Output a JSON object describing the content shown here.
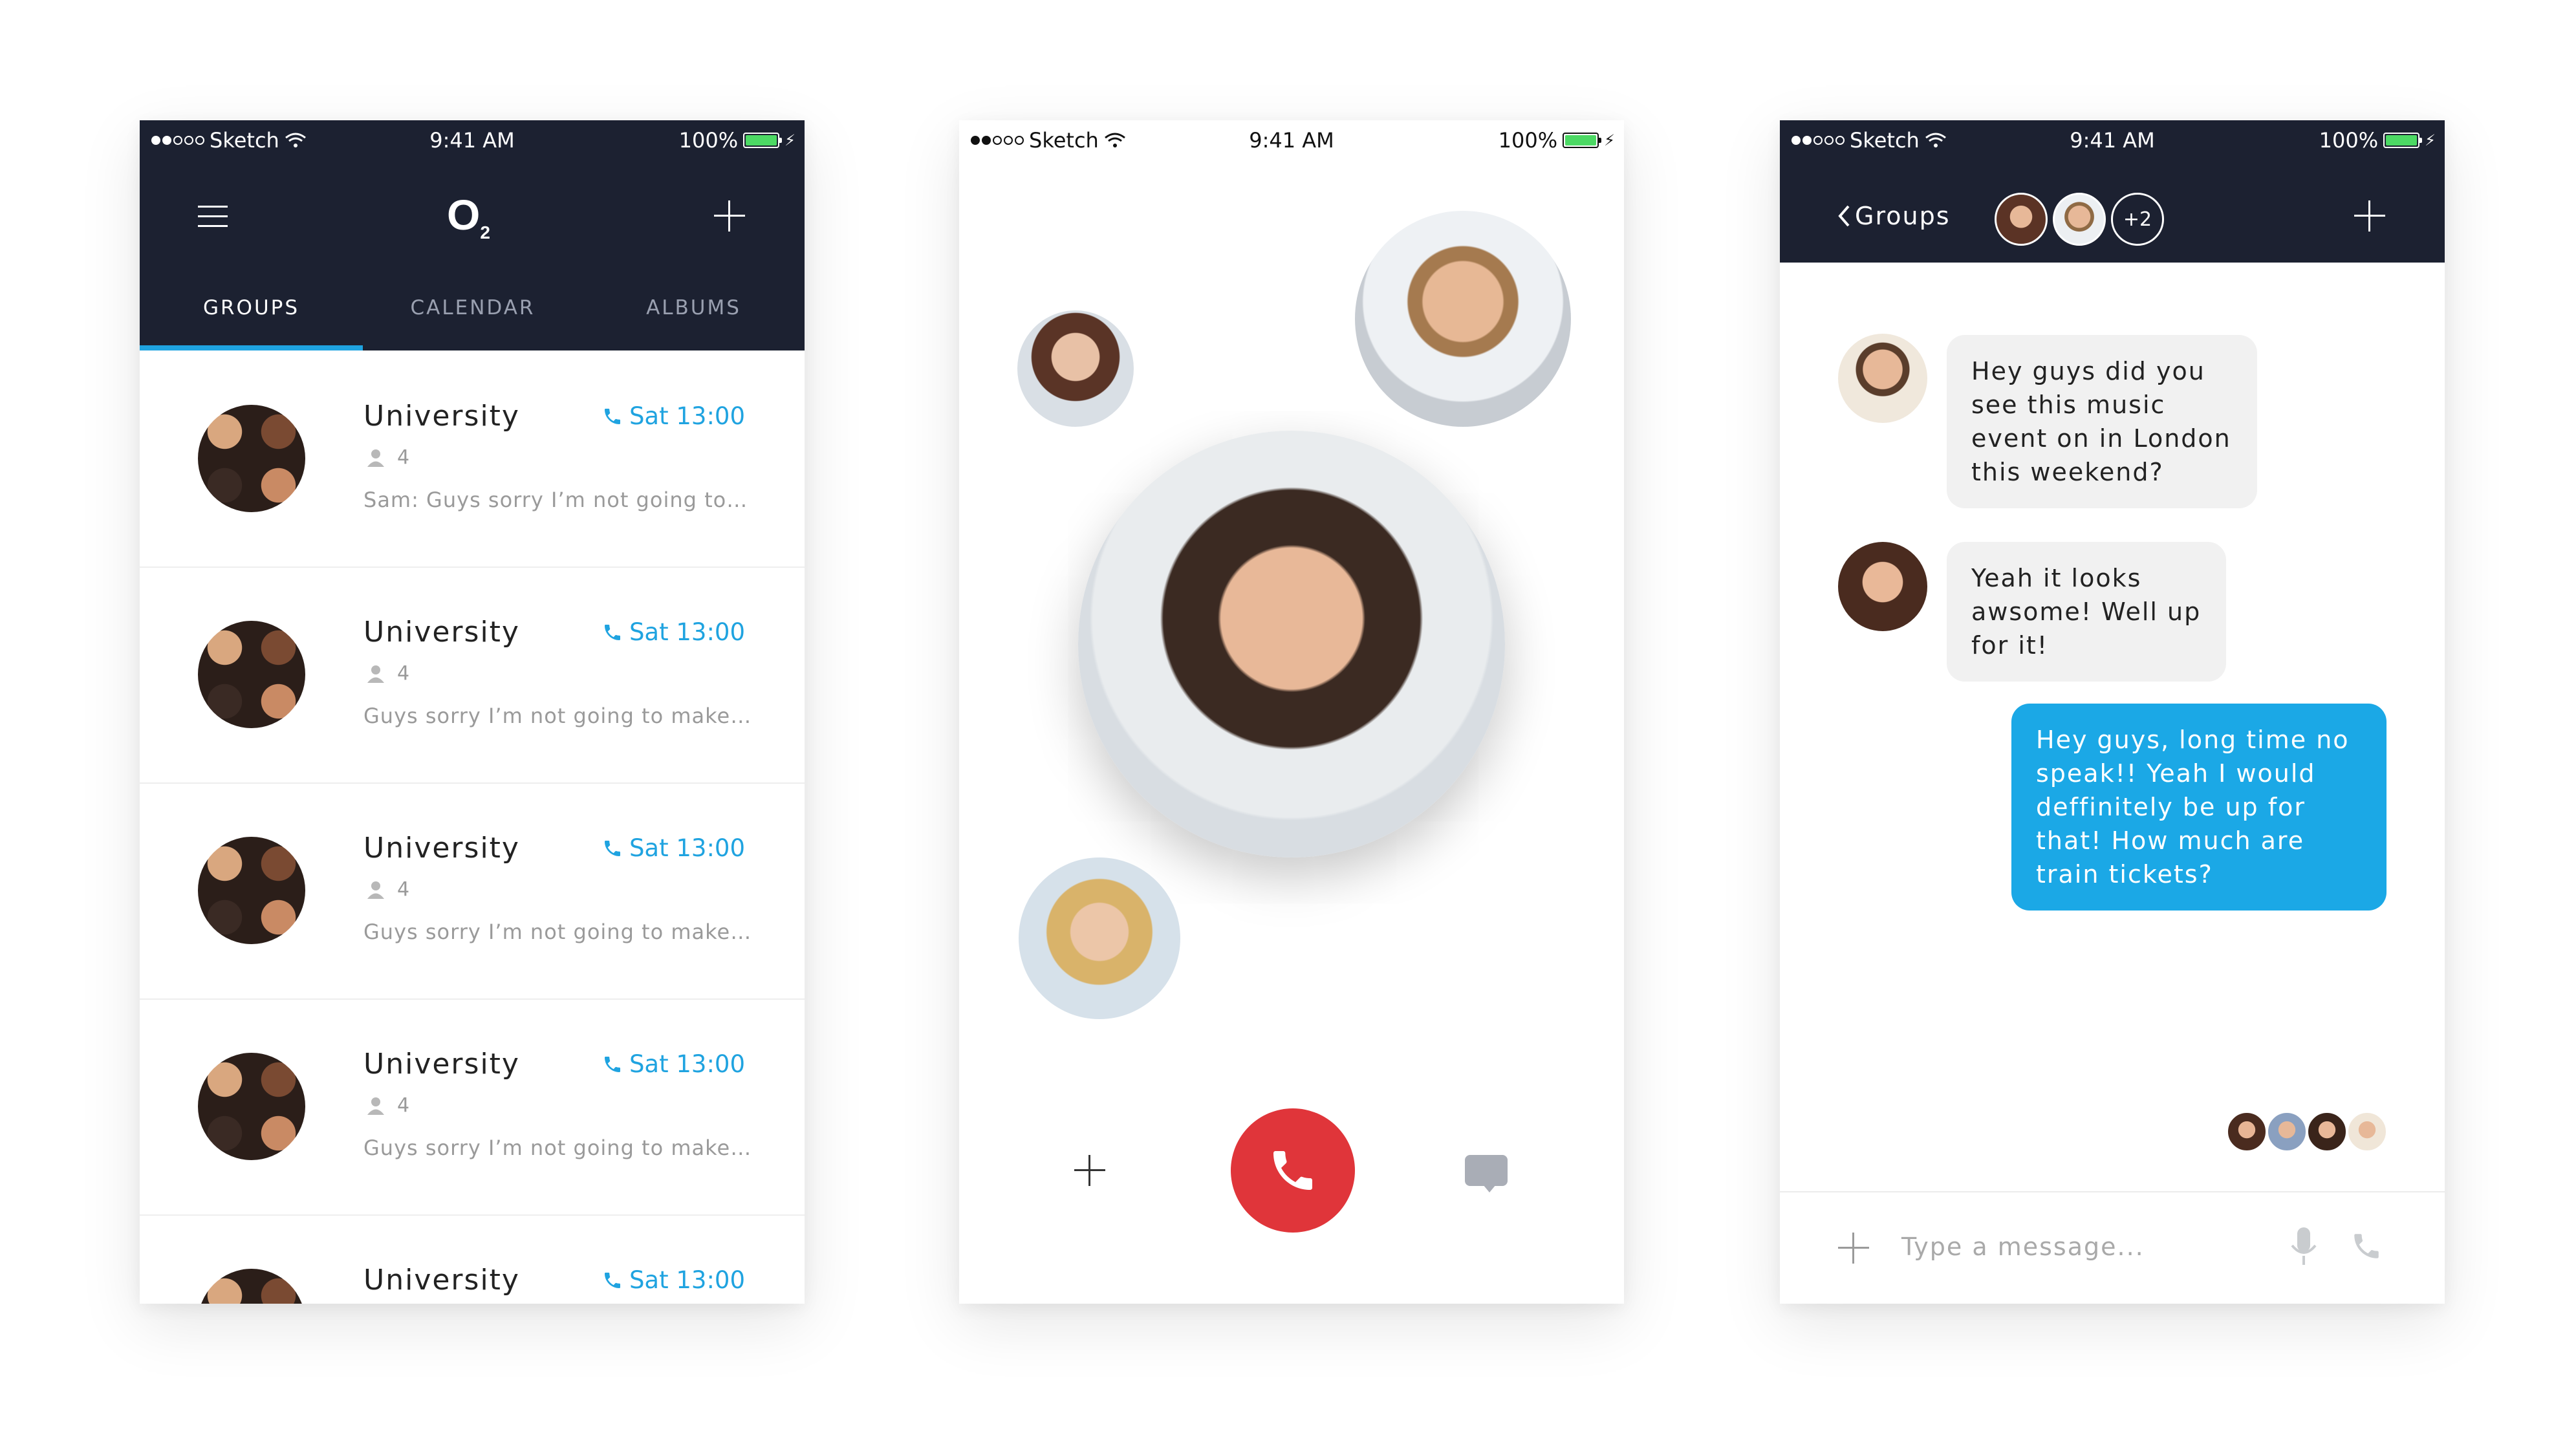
{
  "status_bar": {
    "carrier": "Sketch",
    "time": "9:41 AM",
    "battery": "100%"
  },
  "groups_screen": {
    "logo": "O",
    "logo_sub": "2",
    "tabs": [
      {
        "label": "GROUPS",
        "active": true
      },
      {
        "label": "CALENDAR",
        "active": false
      },
      {
        "label": "ALBUMS",
        "active": false
      }
    ],
    "rows": [
      {
        "title": "University",
        "time": "Sat 13:00",
        "count": "4",
        "preview": "Sam: Guys sorry I’m not going to b…"
      },
      {
        "title": "University",
        "time": "Sat 13:00",
        "count": "4",
        "preview": "Guys sorry I’m not going to make t…"
      },
      {
        "title": "University",
        "time": "Sat 13:00",
        "count": "4",
        "preview": "Guys sorry I’m not going to make t…"
      },
      {
        "title": "University",
        "time": "Sat 13:00",
        "count": "4",
        "preview": "Guys sorry I’m not going to make t…"
      },
      {
        "title": "University",
        "time": "Sat 13:00",
        "count": "",
        "preview": ""
      }
    ]
  },
  "call_screen": {
    "icons": [
      "add-participant-icon",
      "end-call-icon",
      "chat-icon"
    ],
    "colors": {
      "end_call": "#e0353a"
    }
  },
  "chat_screen": {
    "back_label": "Groups",
    "more_participants": "+2",
    "messages": [
      {
        "from": "in",
        "text": "Hey guys did you see this music event on in London this weekend?"
      },
      {
        "from": "in",
        "text": "Yeah it looks awsome! Well up for it!"
      },
      {
        "from": "out",
        "text": "Hey guys, long time no speak!! Yeah I would deffinitely be up for that! How much are train tickets?"
      }
    ],
    "composer_placeholder": "Type a message...",
    "colors": {
      "accent": "#1ba8e6",
      "header": "#1c2131"
    }
  }
}
